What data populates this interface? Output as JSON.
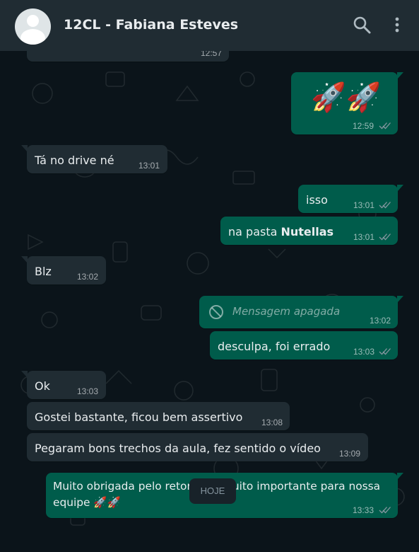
{
  "header": {
    "title": "12CL - Fabiana Esteves"
  },
  "messages": [
    {
      "dir": "in",
      "text": "",
      "time": "12:57"
    },
    {
      "dir": "out",
      "text": "🚀🚀",
      "time": "12:59",
      "ticks": "double"
    },
    {
      "dir": "in",
      "text": "Tá no drive né",
      "time": "13:01"
    },
    {
      "dir": "out",
      "text": "isso",
      "time": "13:01",
      "ticks": "double"
    },
    {
      "dir": "out",
      "text_prefix": "na pasta ",
      "text_bold": "Nutellas",
      "time": "13:01",
      "ticks": "double"
    },
    {
      "dir": "in",
      "text": "Blz",
      "time": "13:02"
    },
    {
      "dir": "out",
      "deleted": true,
      "text": "Mensagem apagada",
      "time": "13:02"
    },
    {
      "dir": "out",
      "text": "desculpa, foi errado",
      "time": "13:03",
      "ticks": "double"
    },
    {
      "dir": "in",
      "text": "Ok",
      "time": "13:03"
    },
    {
      "dir": "in",
      "text": "Gostei bastante, ficou bem assertivo",
      "time": "13:08"
    },
    {
      "dir": "in",
      "text": "Pegaram bons trechos da aula, fez sentido o vídeo",
      "time": "13:09"
    },
    {
      "dir": "out",
      "text_line1": "Muito obrigada pelo retorno, é muito importante para nossa",
      "text_line2": "equipe 🚀🚀",
      "time": "13:33",
      "ticks": "double"
    }
  ],
  "day_divider": "HOJE",
  "icons": {
    "header": [
      "avatar",
      "search-icon",
      "menu-dots-icon"
    ],
    "message": [
      "double-check-icon",
      "deleted-icon"
    ]
  },
  "colors": {
    "header_bg": "#202c33",
    "chat_bg": "#0b141a",
    "incoming": "#202c33",
    "outgoing": "#005c4b"
  }
}
